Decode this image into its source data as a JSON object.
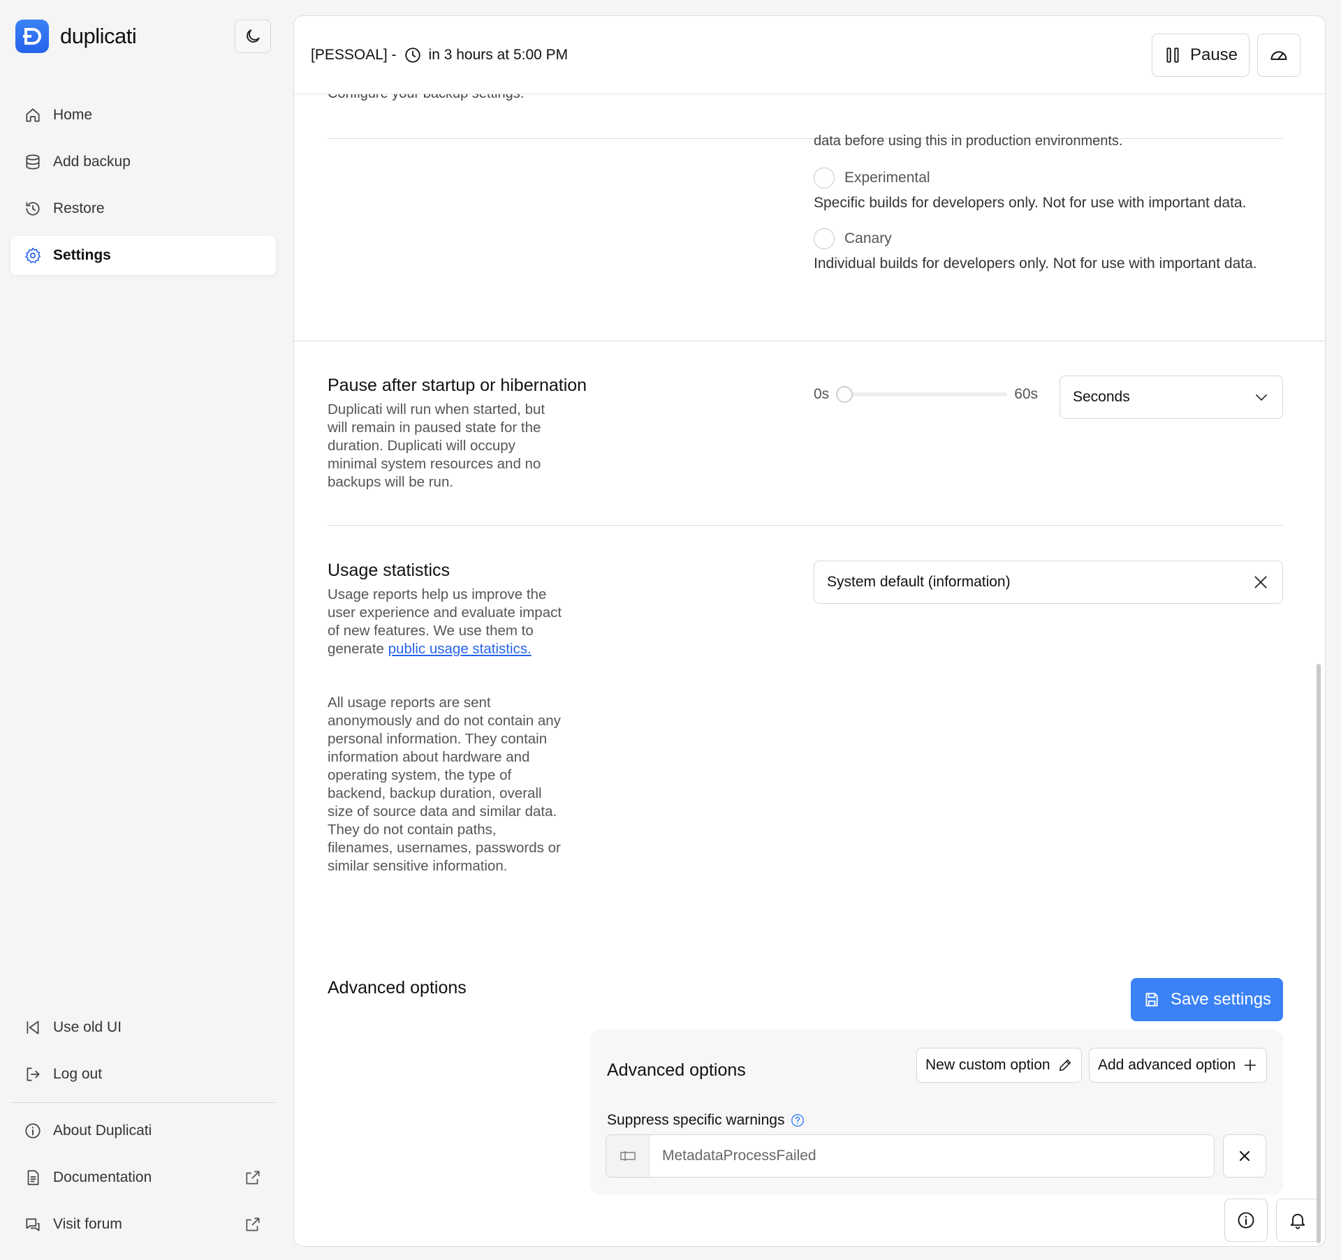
{
  "app": {
    "name": "duplicati"
  },
  "sidebar": {
    "nav": [
      {
        "label": "Home",
        "icon": "home-icon"
      },
      {
        "label": "Add backup",
        "icon": "database-icon"
      },
      {
        "label": "Restore",
        "icon": "history-icon"
      },
      {
        "label": "Settings",
        "icon": "gear-icon",
        "active": true
      }
    ],
    "bottom": [
      {
        "label": "Use old UI",
        "icon": "arrow-left-bar-icon"
      },
      {
        "label": "Log out",
        "icon": "logout-icon"
      }
    ],
    "links": [
      {
        "label": "About Duplicati",
        "icon": "info-icon"
      },
      {
        "label": "Documentation",
        "icon": "document-icon"
      },
      {
        "label": "Visit forum",
        "icon": "chat-icon"
      }
    ]
  },
  "topbar": {
    "backup_name": "[PESSOAL] -",
    "next_run": "in 3 hours at 5:00 PM",
    "pause_label": "Pause"
  },
  "settings": {
    "cut_top_text": "Configure your backup settings.",
    "cut_channel_text": "data before using this in production environments.",
    "channels": [
      {
        "label": "Experimental",
        "desc": "Specific builds for developers only. Not for use with important data."
      },
      {
        "label": "Canary",
        "desc": "Individual builds for developers only. Not for use with important data."
      }
    ],
    "pause": {
      "title": "Pause after startup or hibernation",
      "desc": "Duplicati will run when started, but will remain in paused state for the duration. Duplicati will occupy minimal system resources and no backups will be run.",
      "min_label": "0s",
      "max_label": "60s",
      "unit": "Seconds",
      "value": 0
    },
    "usage": {
      "title": "Usage statistics",
      "desc_pre": "Usage reports help us improve the user experience and evaluate impact of new features. We use them to generate ",
      "desc_link": "public usage statistics.",
      "desc2": "All usage reports are sent anonymously and do not contain any personal information. They contain information about hardware and operating system, the type of backend, backup duration, overall size of source data and similar data. They do not contain paths, filenames, usernames, passwords or similar sensitive information.",
      "selected": "System default (information)"
    },
    "advanced": {
      "title": "Advanced options",
      "save_label": "Save settings",
      "panel_title": "Advanced options",
      "new_custom_label": "New custom option",
      "add_advanced_label": "Add advanced option",
      "field_label": "Suppress specific warnings",
      "field_value": "MetadataProcessFailed"
    }
  },
  "colors": {
    "accent": "#3b82f6",
    "link": "#2563eb"
  }
}
